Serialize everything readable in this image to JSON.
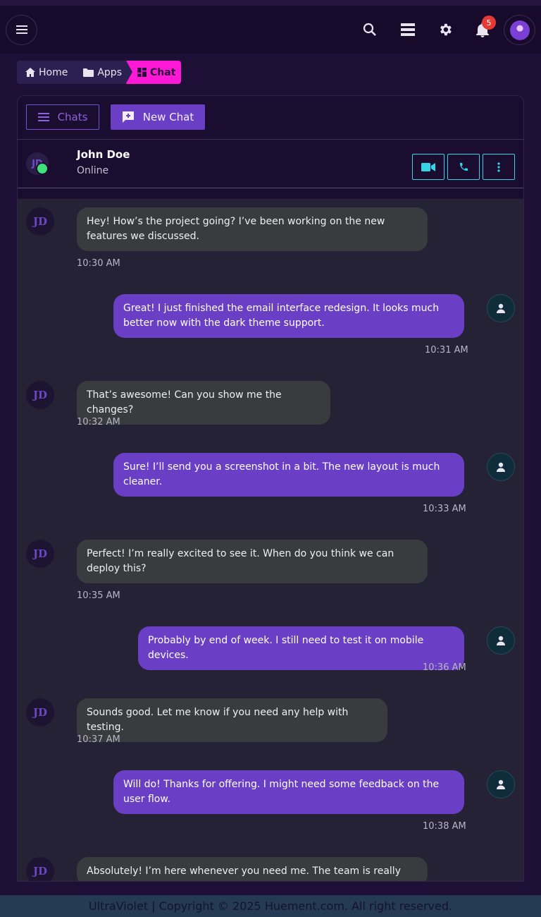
{
  "breadcrumb": {
    "home": "Home",
    "apps": "Apps",
    "current": "Chat"
  },
  "header": {
    "notification_count": "5"
  },
  "toolbar": {
    "chats_label": "Chats",
    "new_chat_label": "New Chat"
  },
  "conversation": {
    "avatar_initials": "JD",
    "name": "John Doe",
    "status": "Online"
  },
  "messages": [
    {
      "from": "in",
      "avatar": "JD",
      "text": "Hey! How’s the project going? I’ve been working on the new features we discussed.",
      "time": "10:30 AM"
    },
    {
      "from": "out",
      "text": "Great! I just finished the email interface redesign. It looks much better now with the dark theme support.",
      "time": "10:31 AM"
    },
    {
      "from": "in",
      "avatar": "JD",
      "text": "That’s awesome! Can you show me the changes?",
      "time": "10:32 AM"
    },
    {
      "from": "out",
      "text": "Sure! I’ll send you a screenshot in a bit. The new layout is much cleaner.",
      "time": "10:33 AM"
    },
    {
      "from": "in",
      "avatar": "JD",
      "text": "Perfect! I’m really excited to see it. When do you think we can deploy this?",
      "time": "10:35 AM"
    },
    {
      "from": "out",
      "text": "Probably by end of week. I still need to test it on mobile devices.",
      "time": "10:36 AM"
    },
    {
      "from": "in",
      "avatar": "JD",
      "text": "Sounds good. Let me know if you need any help with testing.",
      "time": "10:37 AM"
    },
    {
      "from": "out",
      "text": "Will do! Thanks for offering. I might need some feedback on the user flow.",
      "time": "10:38 AM"
    },
    {
      "from": "in",
      "avatar": "JD",
      "text": "Absolutely! I’m here whenever you need me. The team is really",
      "time": ""
    }
  ],
  "footer": {
    "text": "UltraViolet | Copyright © 2025 Huement.com. All right reserved."
  },
  "colors": {
    "accent": "#6a3fc6",
    "breadcrumb_active": "#ff19d6",
    "online": "#3ee07a",
    "action_border": "#37d4e8"
  },
  "icons": [
    "menu-icon",
    "search-icon",
    "layers-icon",
    "gear-icon",
    "bell-icon",
    "home-icon",
    "folder-icon",
    "grid-icon",
    "video-icon",
    "phone-icon",
    "more-vertical-icon",
    "person-icon"
  ]
}
